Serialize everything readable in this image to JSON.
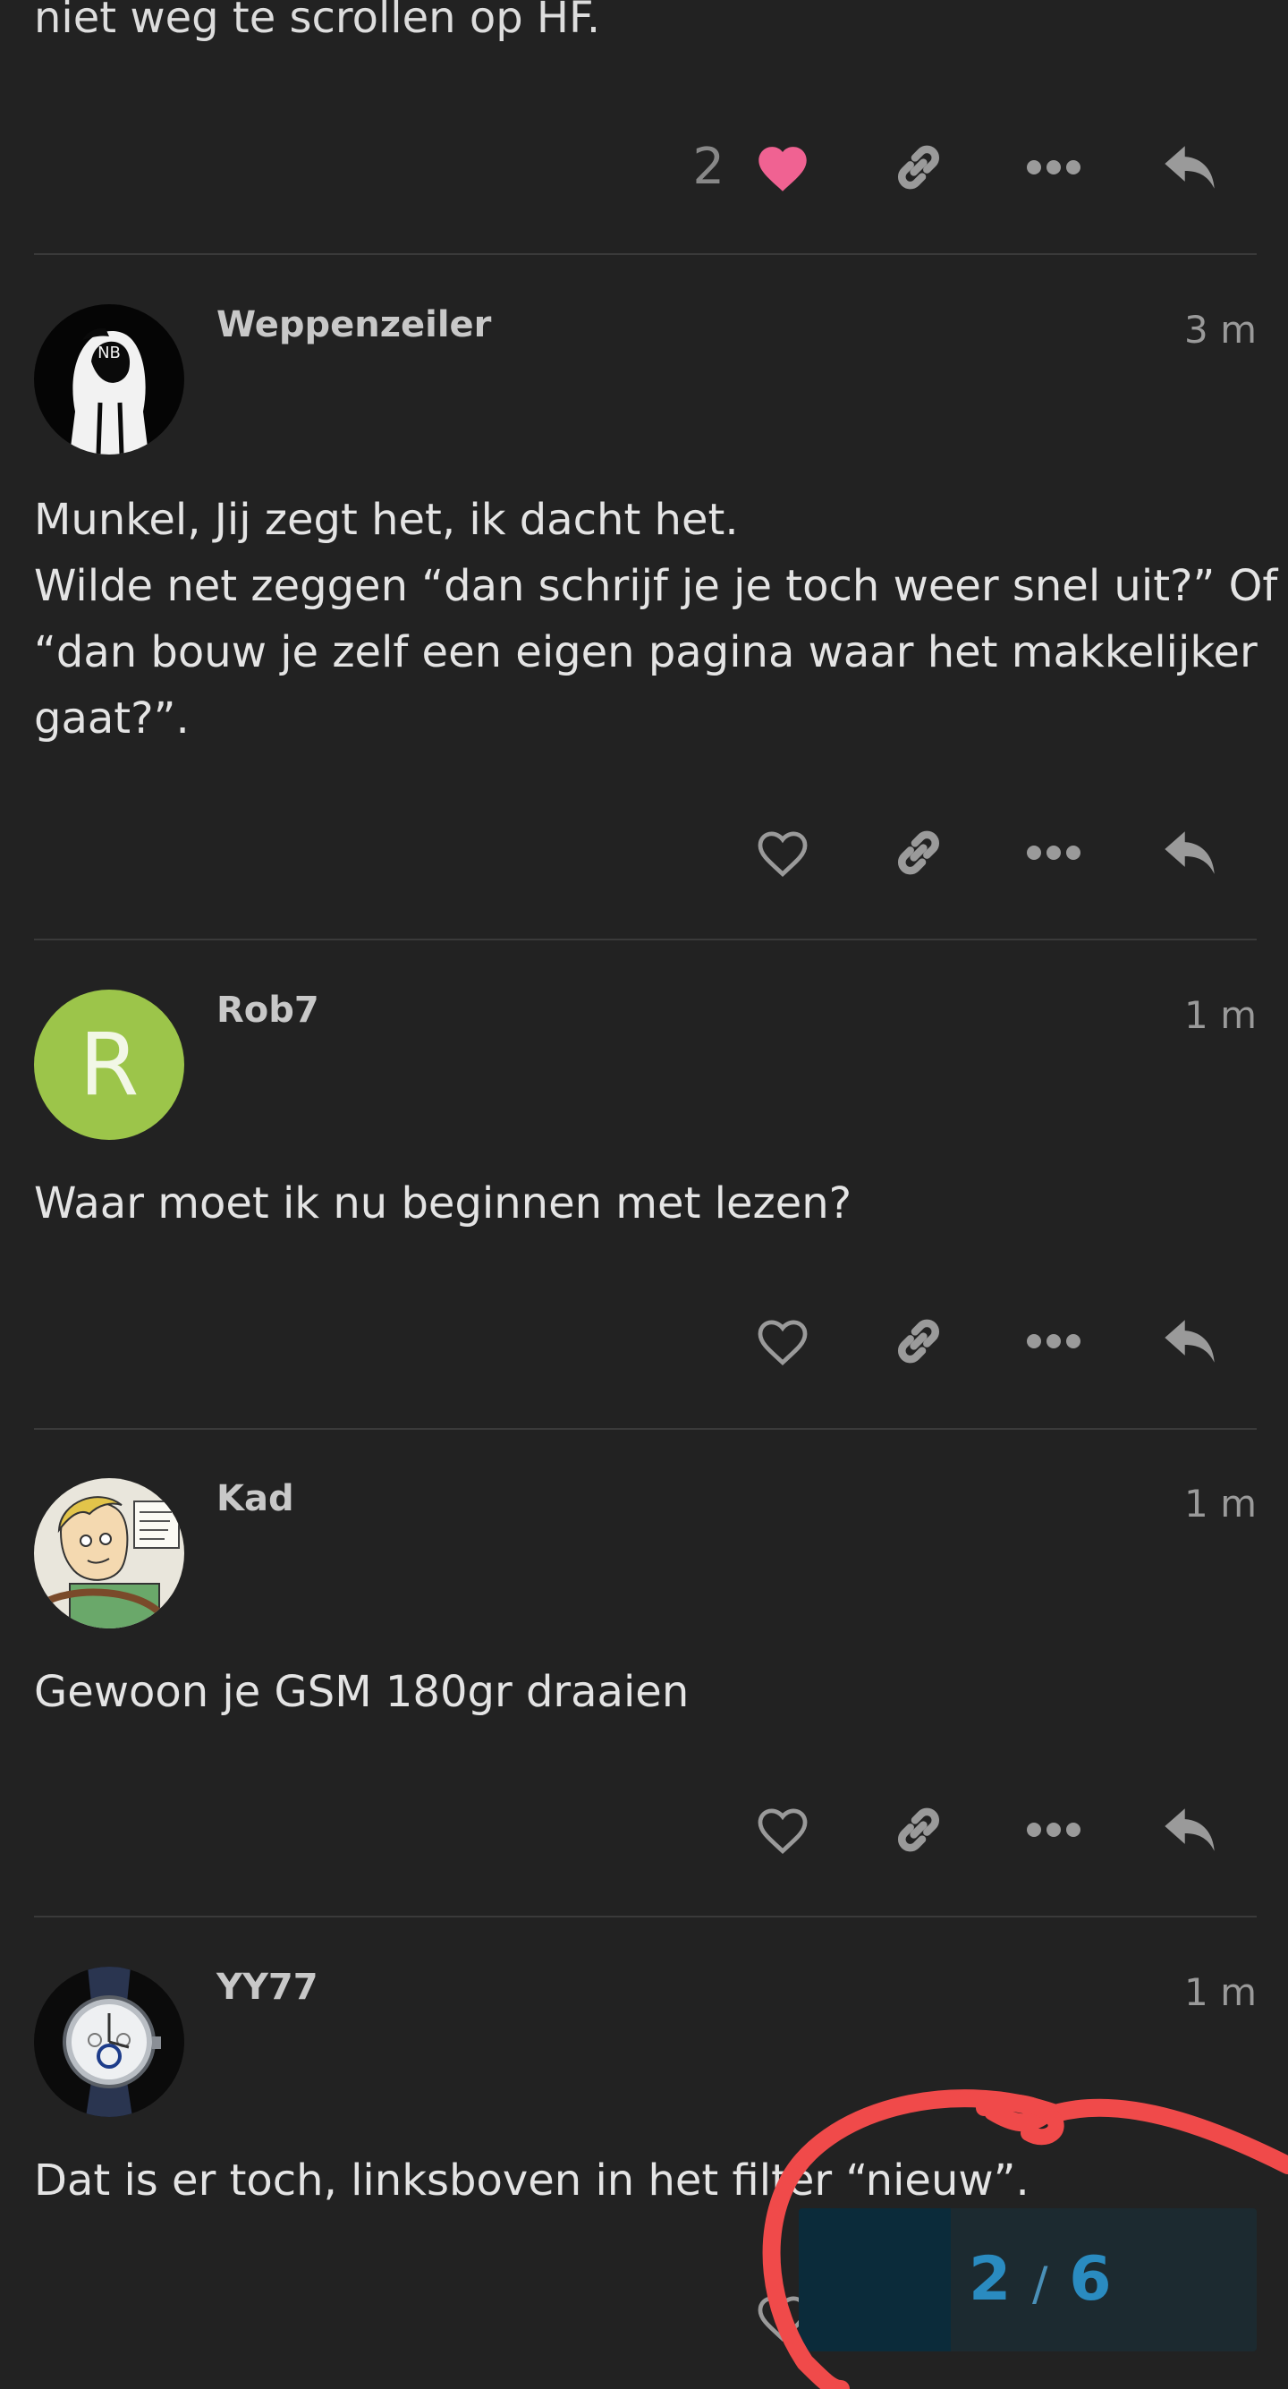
{
  "intro": {
    "text": "niet weg te scrollen op HF.",
    "like_count": "2"
  },
  "posts": [
    {
      "username": "Weppenzeiler",
      "time": "3 m",
      "lines": [
        "Munkel, Jij zegt het, ik dacht het.",
        "Wilde net zeggen “dan schrijf je je toch weer snel uit?” Of",
        "“dan bouw je zelf een eigen pagina waar het makkelijker",
        "gaat?”."
      ]
    },
    {
      "username": "Rob7",
      "time": "1 m",
      "avatar_letter": "R",
      "avatar_color": "#9cc54a",
      "lines": [
        "Waar moet ik nu beginnen met lezen?"
      ]
    },
    {
      "username": "Kad",
      "time": "1 m",
      "lines": [
        "Gewoon je GSM 180gr draaien"
      ]
    },
    {
      "username": "YY77",
      "time": "1 m",
      "lines": [
        "Dat is er toch, linksboven in het filter “nieuw”."
      ]
    }
  ],
  "progress": {
    "current": "2",
    "separator": "/",
    "total": "6",
    "fill_fraction": 0.333
  },
  "colors": {
    "background": "#222222",
    "liked_heart": "#f06292",
    "icon": "#9a9a9a",
    "progress_text": "#2a8bc0",
    "annotation_circle": "#f04a4a"
  },
  "icons": [
    "heart-icon",
    "link-icon",
    "more-icon",
    "reply-icon"
  ]
}
